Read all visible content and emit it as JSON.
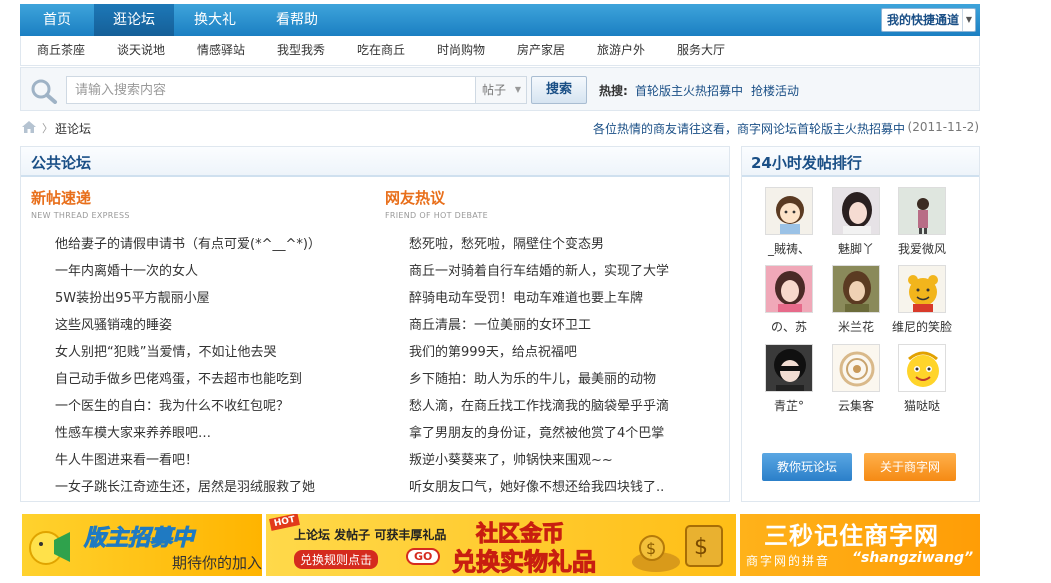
{
  "nav": {
    "items": [
      "首页",
      "逛论坛",
      "换大礼",
      "看帮助"
    ],
    "active_index": 1,
    "quick_access": "我的快捷通道"
  },
  "subnav": [
    "商丘茶座",
    "谈天说地",
    "情感驿站",
    "我型我秀",
    "吃在商丘",
    "时尚购物",
    "房产家居",
    "旅游户外",
    "服务大厅"
  ],
  "search": {
    "placeholder": "请输入搜索内容",
    "type": "帖子",
    "button": "搜索",
    "hot_label": "热搜:",
    "hot_links": [
      "首轮版主火热招募中",
      "抢楼活动"
    ]
  },
  "breadcrumb": {
    "current": "逛论坛",
    "notice": "各位热情的商友请往这看，商字网论坛首轮版主火热招募中",
    "notice_date": "(2011-11-2)"
  },
  "forum": {
    "title": "公共论坛",
    "new_threads": {
      "title": "新帖速递",
      "subtitle": "NEW THREAD EXPRESS",
      "items": [
        "他给妻子的请假申请书（有点可爱(*^__^*)）",
        "一年内离婚十一次的女人",
        "5W装扮出95平方靓丽小屋",
        "这些风骚销魂的睡姿",
        "女人别把“犯贱”当爱情，不如让他去哭",
        "自己动手做乡巴佬鸡蛋，不去超市也能吃到",
        "一个医生的自白：我为什么不收红包呢？",
        "性感车模大家来养养眼吧…",
        "牛人牛图进来看一看吧！",
        "一女子跳长江奇迹生还，居然是羽绒服救了她"
      ]
    },
    "hot_debate": {
      "title": "网友热议",
      "subtitle": "FRIEND OF HOT DEBATE",
      "items": [
        "愁死啦，愁死啦，隔壁住个变态男",
        "商丘一对骑着自行车结婚的新人，实现了大学",
        "醉骑电动车受罚！电动车难道也要上车牌",
        "商丘清晨：一位美丽的女环卫工",
        "我们的第999天，给点祝福吧",
        "乡下随拍：助人为乐的牛儿，最美丽的动物",
        "愁人滴，在商丘找工作找滴我的脑袋晕乎乎滴",
        "拿了男朋友的身份证，竟然被他赏了4个巴掌",
        "叛逆小葵葵来了，帅锅快来围观~~",
        "听女朋友口气，她好像不想还给我四块钱了.."
      ]
    }
  },
  "ranking": {
    "title": "24小时发帖排行",
    "users": [
      "_賊祷、",
      "魅脚丫",
      "我爱微风",
      "の、苏",
      "米兰花",
      "维尼的笑脸",
      "青芷°",
      "云集客",
      "猫哒哒"
    ],
    "learn_button": "教你玩论坛",
    "about_button": "关于商字网"
  },
  "banners": {
    "b1_title": "版主招募中",
    "b1_sub": "期待你的加入",
    "b2_hot": "HOT",
    "b2_line1": "上论坛 发帖子 可获丰厚礼品",
    "b2_rule": "兑换规则点击",
    "b2_go": "GO",
    "b2_big1": "社区金币",
    "b2_big2": "兑换实物礼品",
    "b3_title": "三秒记住商字网",
    "b3_sub": "商字网的拼音",
    "b3_pinyin": "“shangziwang”"
  },
  "colors": {
    "nav_blue": "#1b7fc2",
    "link_blue": "#1a4f86",
    "orange_title": "#e86f1b"
  }
}
